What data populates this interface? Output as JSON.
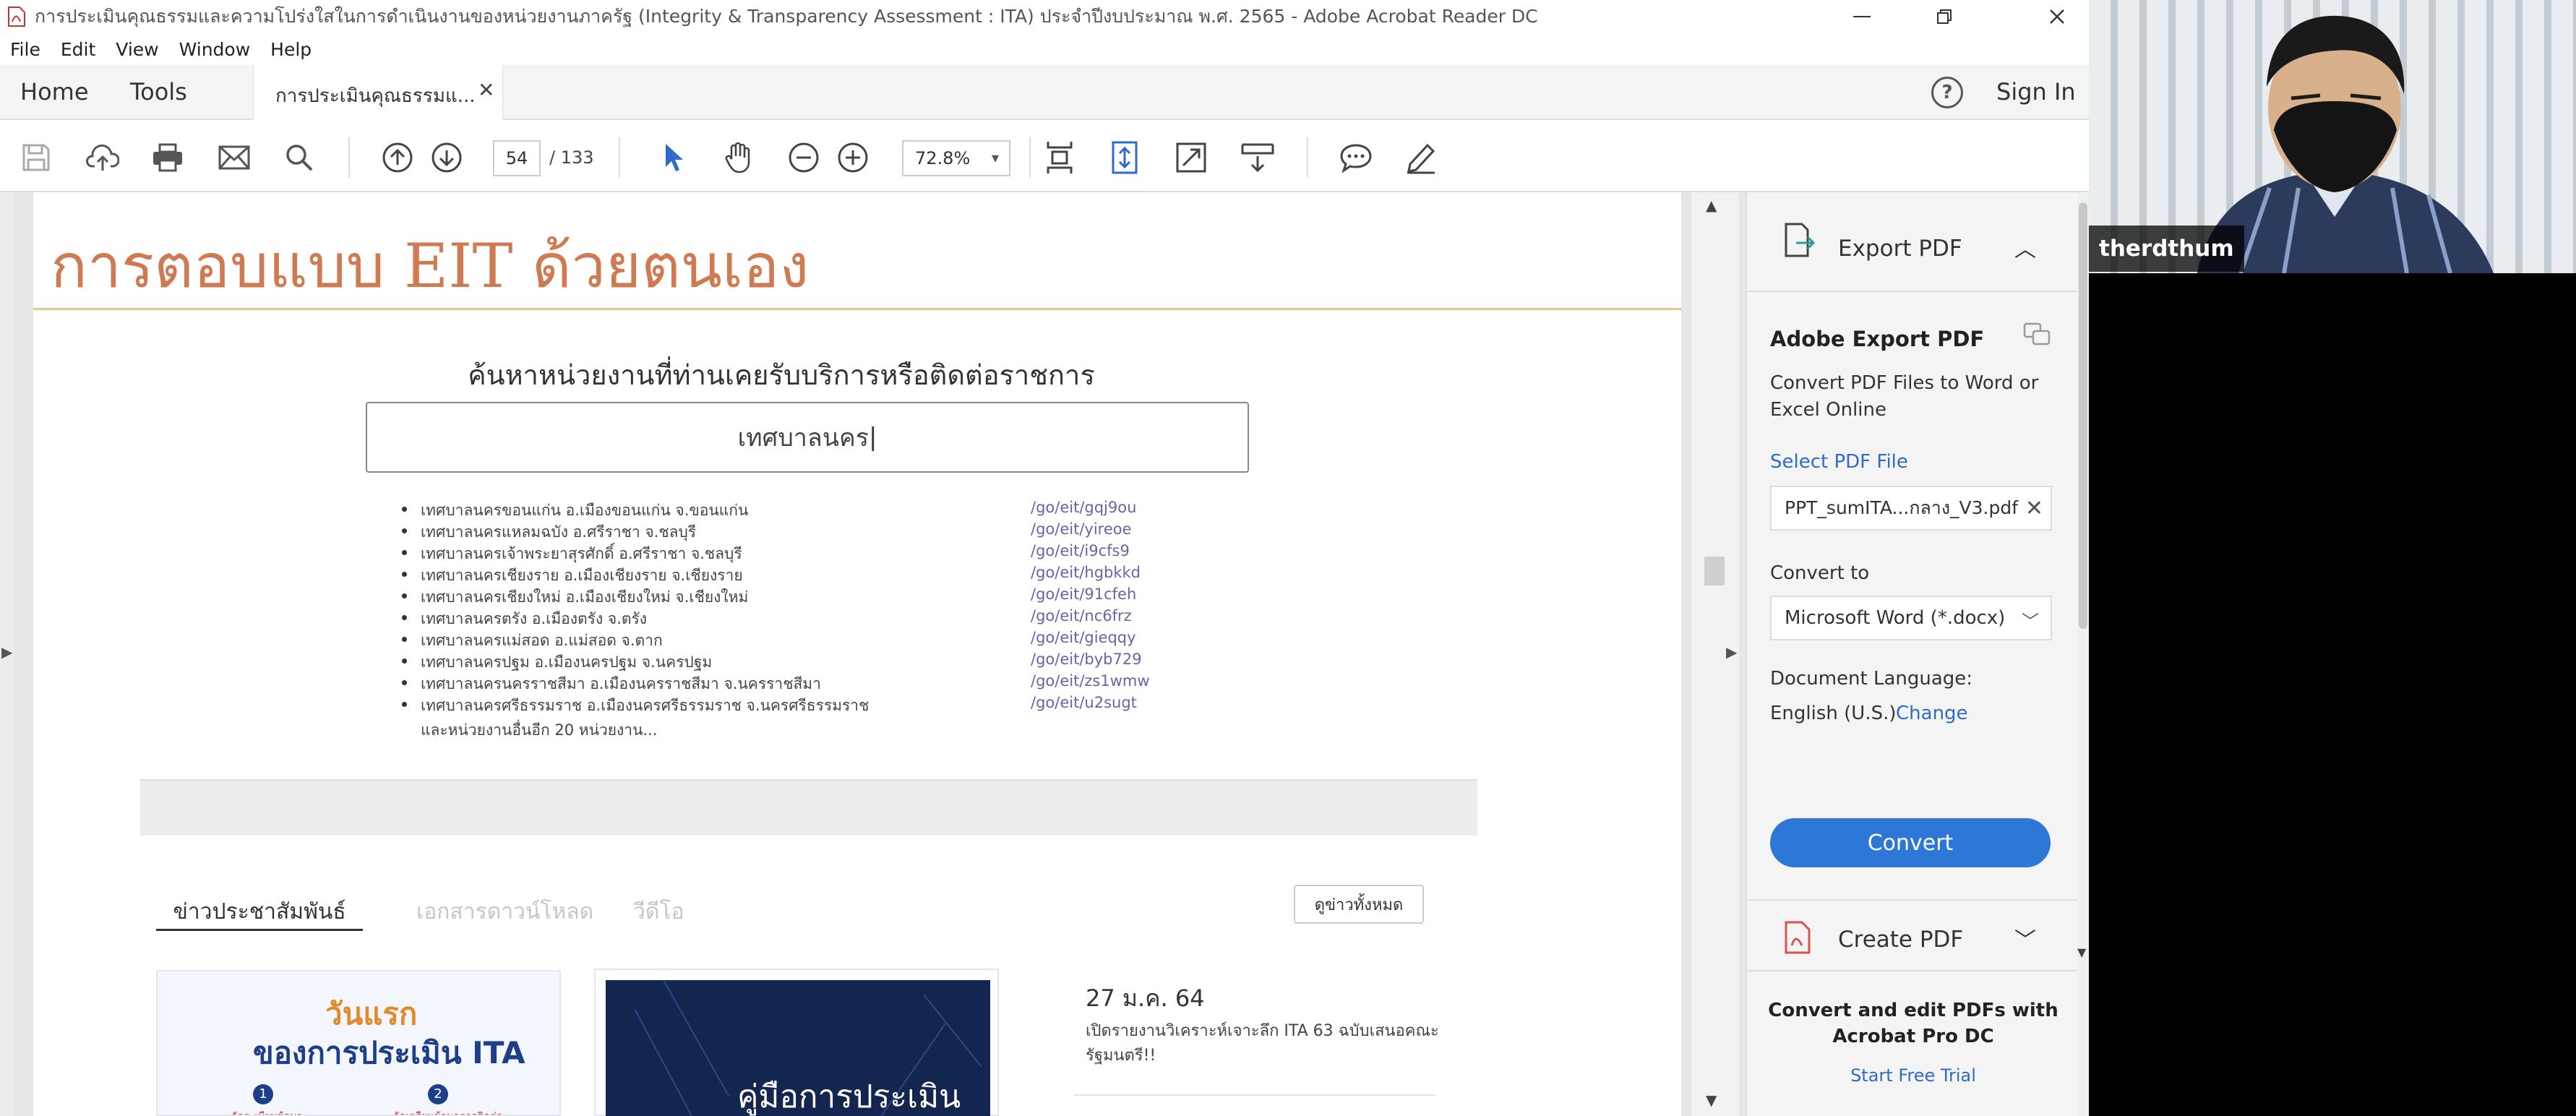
{
  "window": {
    "title": "การประเมินคุณธรรมและความโปร่งใสในการดำเนินงานของหน่วยงานภาครัฐ (Integrity & Transparency Assessment : ITA) ประจำปีงบประมาณ พ.ศ. 2565 - Adobe Acrobat Reader DC"
  },
  "menu": [
    "File",
    "Edit",
    "View",
    "Window",
    "Help"
  ],
  "nav": {
    "home": "Home",
    "tools": "Tools",
    "doc_tab": "การประเมินคุณธรรมแ...",
    "sign_in": "Sign In"
  },
  "toolbar": {
    "page_current": "54",
    "page_total": "/ 133",
    "zoom": "72.8%"
  },
  "slide": {
    "title": "การตอบแบบ EIT ด้วยตนเอง",
    "search_heading": "ค้นหาหน่วยงานที่ท่านเคยรับบริการหรือติดต่อราชการ",
    "search_value": "เทศบาลนคร",
    "results": [
      {
        "name": "เทศบาลนครขอนแก่น อ.เมืองขอนแก่น จ.ขอนแก่น",
        "link": "/go/eit/gqj9ou"
      },
      {
        "name": "เทศบาลนครแหลมฉบัง อ.ศรีราชา จ.ชลบุรี",
        "link": "/go/eit/yireoe"
      },
      {
        "name": "เทศบาลนครเจ้าพระยาสุรศักดิ์ อ.ศรีราชา จ.ชลบุรี",
        "link": "/go/eit/i9cfs9"
      },
      {
        "name": "เทศบาลนครเชียงราย อ.เมืองเชียงราย จ.เชียงราย",
        "link": "/go/eit/hgbkkd"
      },
      {
        "name": "เทศบาลนครเชียงใหม่ อ.เมืองเชียงใหม่ จ.เชียงใหม่",
        "link": "/go/eit/91cfeh"
      },
      {
        "name": "เทศบาลนครตรัง อ.เมืองตรัง จ.ตรัง",
        "link": "/go/eit/nc6frz"
      },
      {
        "name": "เทศบาลนครแม่สอด อ.แม่สอด จ.ตาก",
        "link": "/go/eit/gieqqy"
      },
      {
        "name": "เทศบาลนครปฐม อ.เมืองนครปฐม จ.นครปฐม",
        "link": "/go/eit/byb729"
      },
      {
        "name": "เทศบาลนครนครราชสีมา อ.เมืองนครราชสีมา จ.นครราชสีมา",
        "link": "/go/eit/zs1wmw"
      },
      {
        "name": "เทศบาลนครศรีธรรมราช อ.เมืองนครศรีธรรมราช จ.นครศรีธรรมราช",
        "link": "/go/eit/u2sugt"
      }
    ],
    "more_results": "และหน่วยงานอื่นอีก 20 หน่วยงาน...",
    "tabs": [
      "ข่าวประชาสัมพันธ์",
      "เอกสารดาวน์โหลด",
      "วีดีโอ"
    ],
    "see_all": "ดูข่าวทั้งหมด",
    "card1": {
      "line1": "วันแรก",
      "line2": "ของการประเมิน ITA",
      "badge1": "1",
      "badge2": "2",
      "sub1": "จัดระเบียบข้อมูล",
      "sub2": "จัดเตรียมข้อมูลการติดต่อ"
    },
    "card2_text": "คู่มือการประเมิน",
    "news_date": "27 ม.ค. 64",
    "news_text": "เปิดรายงานวิเคราะห์เจาะลึก ITA 63 ฉบับเสนอคณะรัฐมนตรี!!"
  },
  "right_pane": {
    "export_header": "Export PDF",
    "adobe_export_title": "Adobe Export PDF",
    "description": "Convert PDF Files to Word or Excel Online",
    "select_label": "Select PDF File",
    "file_name": "PPT_sumITA...กลาง_V3.pdf",
    "convert_to_label": "Convert to",
    "format": "Microsoft Word (*.docx)",
    "doc_lang_label": "Document Language:",
    "doc_lang_value": "English (U.S.)",
    "change": "Change",
    "convert_button": "Convert",
    "create_header": "Create PDF",
    "promo": "Convert and edit PDFs with Acrobat Pro DC",
    "trial": "Start Free Trial"
  },
  "video": {
    "participant_name": "therdthum"
  },
  "colors": {
    "accent_blue": "#2d77d6",
    "title_orange": "#d07a52",
    "link_purple": "#6c60a8"
  },
  "icons": {
    "toolbar": [
      "save-icon",
      "upload-icon",
      "print-icon",
      "email-icon",
      "search-icon",
      "prev-page-icon",
      "next-page-icon",
      "select-cursor-icon",
      "hand-icon",
      "zoom-out-icon",
      "zoom-in-icon",
      "fit-page-icon",
      "scroll-mode-icon",
      "fullscreen-icon",
      "read-mode-icon",
      "comment-icon",
      "pen-icon"
    ]
  }
}
